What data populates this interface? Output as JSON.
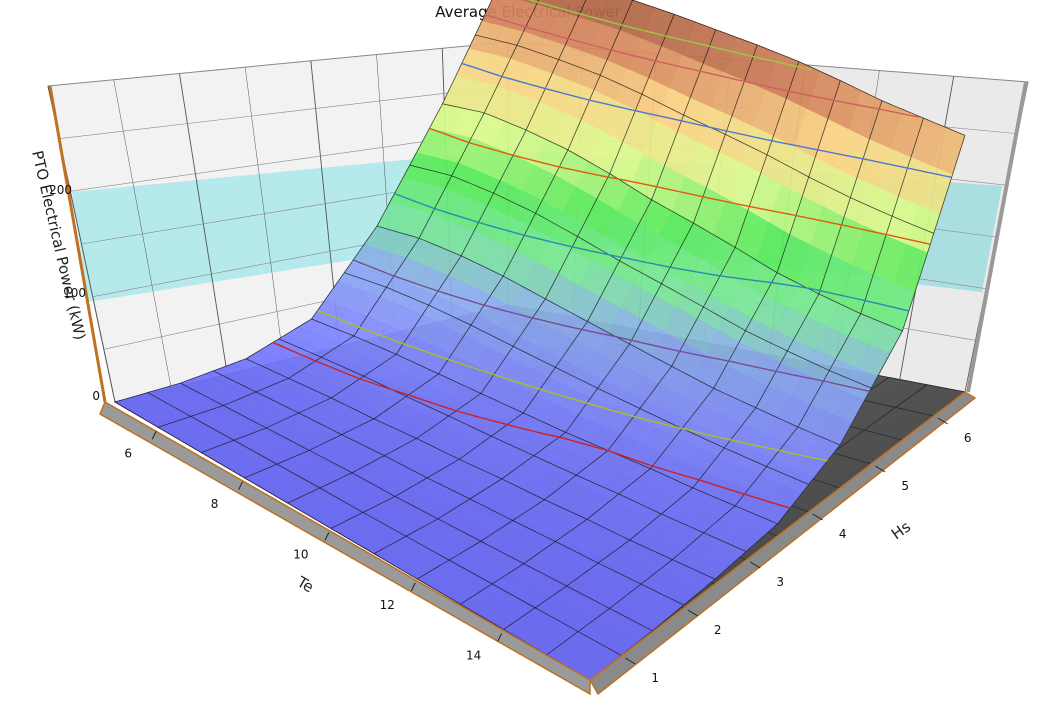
{
  "chart_data": {
    "type": "surface",
    "title": "Average Electrical Power",
    "zlabel": "PTO Electrical Power (kW)",
    "xlabel": "Te",
    "ylabel": "Hs",
    "te_ticks": [
      "6",
      "8",
      "10",
      "12",
      "14"
    ],
    "hs_ticks": [
      "1",
      "2",
      "3",
      "4",
      "5",
      "6"
    ],
    "z_ticks": [
      "0",
      "100",
      "200"
    ],
    "te_range": [
      5,
      16
    ],
    "hs_range": [
      0.5,
      6.5
    ],
    "z_range": [
      0,
      260
    ],
    "te_values": [
      5,
      6,
      7,
      8,
      9,
      10,
      11,
      12,
      13,
      14,
      15,
      16
    ],
    "hs_values": [
      0.5,
      1.5,
      2.5,
      3.5,
      4.5,
      5.5,
      6.5
    ],
    "power_grid_kw": [
      [
        0,
        2,
        8,
        25,
        80,
        155,
        240
      ],
      [
        0,
        2,
        8,
        25,
        82,
        158,
        240
      ],
      [
        0,
        2,
        8,
        24,
        80,
        155,
        240
      ],
      [
        0,
        2,
        7,
        22,
        76,
        150,
        240
      ],
      [
        0,
        2,
        7,
        20,
        70,
        142,
        238
      ],
      [
        0,
        1,
        6,
        18,
        64,
        132,
        235
      ],
      [
        0,
        1,
        6,
        16,
        58,
        124,
        232
      ],
      [
        0,
        1,
        5,
        15,
        52,
        115,
        228
      ],
      [
        0,
        1,
        5,
        14,
        46,
        105,
        222
      ],
      [
        0,
        1,
        4,
        12,
        42,
        98,
        215
      ],
      [
        0,
        1,
        4,
        11,
        38,
        92,
        210
      ],
      [
        0,
        1,
        4,
        10,
        35,
        88,
        205
      ]
    ],
    "contour_levels": [
      15,
      30,
      60,
      100,
      140,
      180,
      210,
      225
    ],
    "contour_colors": [
      "#cc2222",
      "#a8c020",
      "#7a4a9a",
      "#2a8ab0",
      "#e05a10",
      "#4a7ad0",
      "#d06060",
      "#9aca40"
    ],
    "grid": true
  }
}
